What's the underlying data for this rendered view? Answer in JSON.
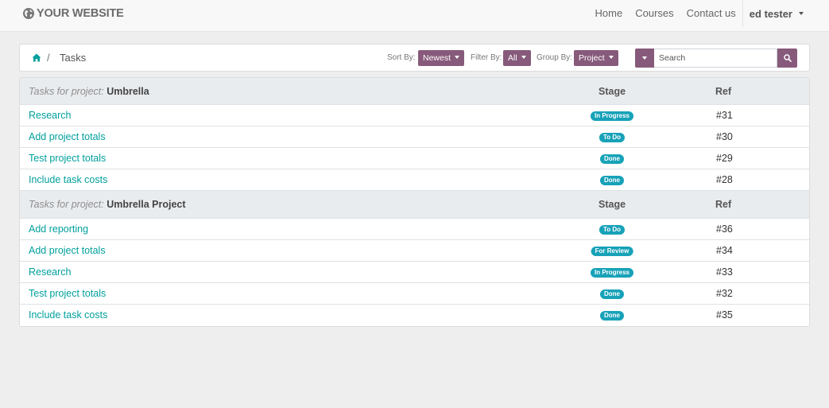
{
  "navbar": {
    "brand": "YOUR WEBSITE",
    "links": [
      "Home",
      "Courses",
      "Contact us"
    ],
    "user": "ed tester"
  },
  "breadcrumb": {
    "current": "Tasks",
    "separator": "/"
  },
  "controls": {
    "sort_label": "Sort By:",
    "sort_value": "Newest",
    "filter_label": "Filter By:",
    "filter_value": "All",
    "group_label": "Group By:",
    "group_value": "Project",
    "search_placeholder": "Search"
  },
  "groups": [
    {
      "prefix": "Tasks for project:",
      "project": "Umbrella",
      "stage_header": "Stage",
      "ref_header": "Ref",
      "tasks": [
        {
          "name": "Research",
          "stage": "In Progress",
          "ref": "#31"
        },
        {
          "name": "Add project totals",
          "stage": "To Do",
          "ref": "#30"
        },
        {
          "name": "Test project totals",
          "stage": "Done",
          "ref": "#29"
        },
        {
          "name": "Include task costs",
          "stage": "Done",
          "ref": "#28"
        }
      ]
    },
    {
      "prefix": "Tasks for project:",
      "project": "Umbrella Project",
      "stage_header": "Stage",
      "ref_header": "Ref",
      "tasks": [
        {
          "name": "Add reporting",
          "stage": "To Do",
          "ref": "#36"
        },
        {
          "name": "Add project totals",
          "stage": "For Review",
          "ref": "#34"
        },
        {
          "name": "Research",
          "stage": "In Progress",
          "ref": "#33"
        },
        {
          "name": "Test project totals",
          "stage": "Done",
          "ref": "#32"
        },
        {
          "name": "Include task costs",
          "stage": "Done",
          "ref": "#35"
        }
      ]
    }
  ],
  "colors": {
    "accent": "#875a7b",
    "link": "#00a09d",
    "badge": "#17a2b8"
  }
}
